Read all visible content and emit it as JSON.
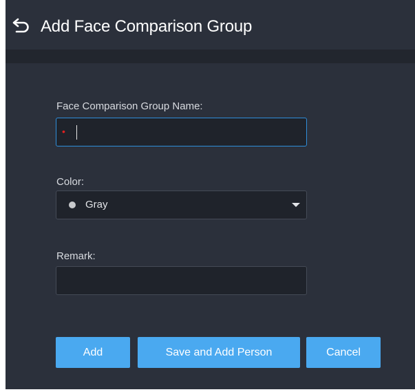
{
  "header": {
    "back_icon": "back-arrow-icon",
    "title": "Add Face Comparison Group"
  },
  "form": {
    "name_label": "Face Comparison Group Name:",
    "name_required_mark": "•",
    "name_value": "",
    "color_label": "Color:",
    "color_value": "Gray",
    "color_swatch": "#c7c9cc",
    "remark_label": "Remark:",
    "remark_value": ""
  },
  "buttons": {
    "add": "Add",
    "save_and_add_person": "Save and Add Person",
    "cancel": "Cancel"
  },
  "colors": {
    "background": "#2b303b",
    "accent": "#4aa9f0",
    "focus_border": "#2f8fdc"
  }
}
